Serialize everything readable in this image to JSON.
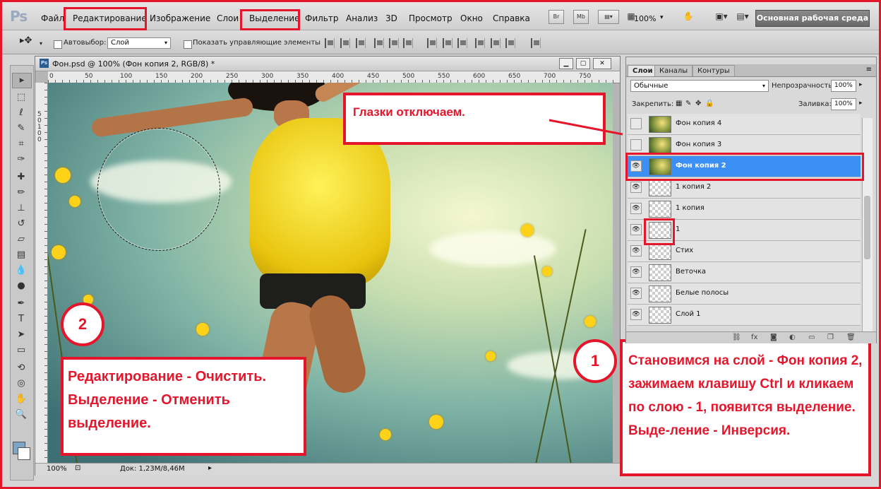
{
  "app": {
    "logo": "Ps"
  },
  "menu": {
    "items": [
      "Файл",
      "Редактирование",
      "Изображение",
      "Слои",
      "Выделение",
      "Фильтр",
      "Анализ",
      "3D",
      "Просмотр",
      "Окно",
      "Справка"
    ],
    "highlighted": [
      "Редактирование",
      "Выделение"
    ]
  },
  "appbar": {
    "bridge_btn": "Br",
    "mini_bridge_btn": "Mb",
    "zoom_level": "100%",
    "workspace": "Основная рабочая среда"
  },
  "options": {
    "autoselect_label": "Автовыбор:",
    "autoselect_value": "Слой",
    "show_controls_label": "Показать управляющие элементы"
  },
  "document": {
    "title": "Фон.psd @ 100% (Фон копия 2, RGB/8) *",
    "ruler_ticks": [
      "0",
      "50",
      "100",
      "150",
      "200",
      "250",
      "300",
      "350",
      "400",
      "450",
      "500",
      "550",
      "600",
      "650",
      "700",
      "750"
    ],
    "ruler_left_ticks": [
      "5",
      "0",
      "1",
      "0",
      "0"
    ],
    "status_zoom": "100%",
    "status_doc": "Док: 1,23M/8,46M"
  },
  "layers_panel": {
    "tabs": [
      "Слои",
      "Каналы",
      "Контуры"
    ],
    "active_tab": "Слои",
    "blend_mode": "Обычные",
    "opacity_label": "Непрозрачность:",
    "opacity_value": "100%",
    "lock_label": "Закрепить:",
    "fill_label": "Заливка:",
    "fill_value": "100%",
    "layers": [
      {
        "name": "Фон копия 4",
        "visible": false,
        "thumb": "photo"
      },
      {
        "name": "Фон копия 3",
        "visible": false,
        "thumb": "photo"
      },
      {
        "name": "Фон копия 2",
        "visible": true,
        "thumb": "photo",
        "selected": true
      },
      {
        "name": "1 копия 2",
        "visible": true,
        "thumb": "transparent"
      },
      {
        "name": "1 копия",
        "visible": true,
        "thumb": "transparent"
      },
      {
        "name": "1",
        "visible": true,
        "thumb": "transparent"
      },
      {
        "name": "Стих",
        "visible": true,
        "thumb": "transparent"
      },
      {
        "name": "Веточка",
        "visible": true,
        "thumb": "transparent"
      },
      {
        "name": "Белые полосы",
        "visible": true,
        "thumb": "transparent"
      },
      {
        "name": "Слой 1",
        "visible": true,
        "thumb": "transparent"
      }
    ],
    "footer_icons": [
      "link-icon",
      "fx-icon",
      "mask-icon",
      "adjustment-icon",
      "group-icon",
      "new-layer-icon",
      "trash-icon"
    ]
  },
  "annotations": {
    "eyes_note": "Глазки отключаем.",
    "step2_num": "2",
    "step2_text": "Редактирование - Очистить. Выделение - Отменить выделение.",
    "step1_num": "1",
    "step1_text": "Становимся на слой - Фон копия 2, зажимаем клавишу Ctrl и кликаем по слою - 1, появится выделение. Выде-ление - Инверсия."
  },
  "colors": {
    "accent": "#e5162b",
    "selected_layer": "#3b8ff5",
    "workspace_btn": "#6f6f6f"
  }
}
